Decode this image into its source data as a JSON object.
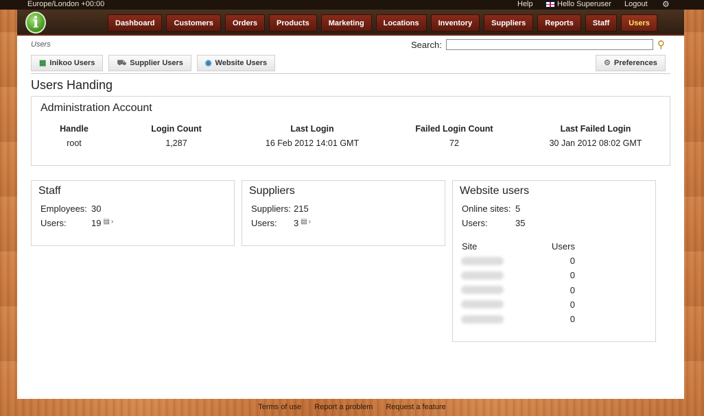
{
  "topbar": {
    "timezone": "Europe/London +00:00",
    "help": "Help",
    "hello": "Hello Superuser",
    "logout": "Logout"
  },
  "nav": {
    "tabs": [
      {
        "label": "Dashboard",
        "active": false
      },
      {
        "label": "Customers",
        "active": false
      },
      {
        "label": "Orders",
        "active": false
      },
      {
        "label": "Products",
        "active": false
      },
      {
        "label": "Marketing",
        "active": false
      },
      {
        "label": "Locations",
        "active": false
      },
      {
        "label": "Inventory",
        "active": false
      },
      {
        "label": "Suppliers",
        "active": false
      },
      {
        "label": "Reports",
        "active": false
      },
      {
        "label": "Staff",
        "active": false
      },
      {
        "label": "Users",
        "active": true
      }
    ]
  },
  "breadcrumb": "Users",
  "search": {
    "label": "Search:",
    "value": ""
  },
  "subtabs": {
    "inikoo_users": "Inikoo Users",
    "supplier_users": "Supplier Users",
    "website_users": "Website Users",
    "preferences": "Preferences"
  },
  "page_title": "Users Handing",
  "admin": {
    "title": "Administration Account",
    "headers": [
      "Handle",
      "Login Count",
      "Last Login",
      "Failed Login Count",
      "Last Failed Login"
    ],
    "row": [
      "root",
      "1,287",
      "16 Feb 2012 14:01 GMT",
      "72",
      "30 Jan 2012 08:02 GMT"
    ]
  },
  "staff": {
    "title": "Staff",
    "employees_label": "Employees:",
    "employees_value": "30",
    "users_label": "Users:",
    "users_value": "19"
  },
  "suppliers": {
    "title": "Suppliers",
    "suppliers_label": "Suppliers:",
    "suppliers_value": "215",
    "users_label": "Users:",
    "users_value": "3"
  },
  "website": {
    "title": "Website users",
    "online_label": "Online sites:",
    "online_value": "5",
    "users_label": "Users:",
    "users_value": "35",
    "col_site": "Site",
    "col_users": "Users",
    "site_users": [
      "0",
      "0",
      "0",
      "0",
      "0"
    ]
  },
  "footer": {
    "terms": "Terms of use",
    "report": "Report a problem",
    "request": "Request a feature"
  },
  "colors": {
    "nav_tab": "#7a2616",
    "active_tab_text": "#ffe45c",
    "header_bg": "#3a2818"
  }
}
